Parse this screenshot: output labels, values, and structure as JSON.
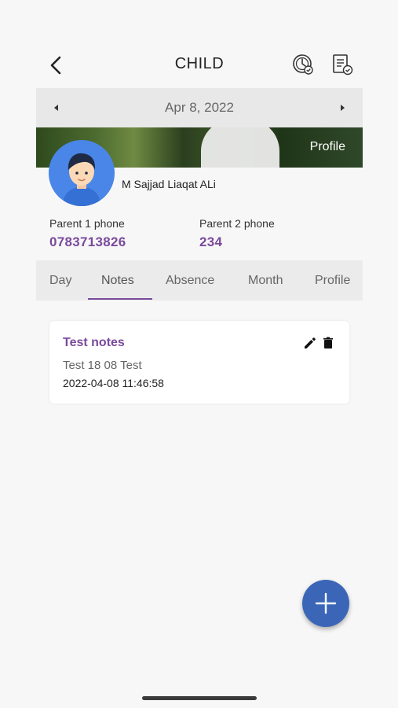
{
  "header": {
    "title": "CHILD"
  },
  "date_bar": {
    "date": "Apr 8, 2022"
  },
  "banner": {
    "profile_label": "Profile"
  },
  "child": {
    "name": "M Sajjad Liaqat ALi"
  },
  "parents": {
    "parent1_label": "Parent 1 phone",
    "parent1_phone": "0783713826",
    "parent2_label": "Parent 2 phone",
    "parent2_phone": "234"
  },
  "tabs": [
    {
      "label": "Day"
    },
    {
      "label": "Notes"
    },
    {
      "label": "Absence"
    },
    {
      "label": "Month"
    },
    {
      "label": "Profile"
    }
  ],
  "active_tab": "Notes",
  "notes": [
    {
      "title": "Test notes",
      "body": "Test 18 08 Test",
      "timestamp": "2022-04-08 11:46:58"
    }
  ],
  "colors": {
    "accent": "#7a4a9c",
    "fab": "#3b66b8",
    "avatar_bg": "#4a86e8"
  },
  "icons": {
    "back": "back-arrow-icon",
    "attendance": "clock-attendance-icon",
    "report": "report-check-icon",
    "prev_date": "caret-left-icon",
    "next_date": "caret-right-icon",
    "edit": "pencil-icon",
    "delete": "trash-icon",
    "add": "plus-icon"
  }
}
